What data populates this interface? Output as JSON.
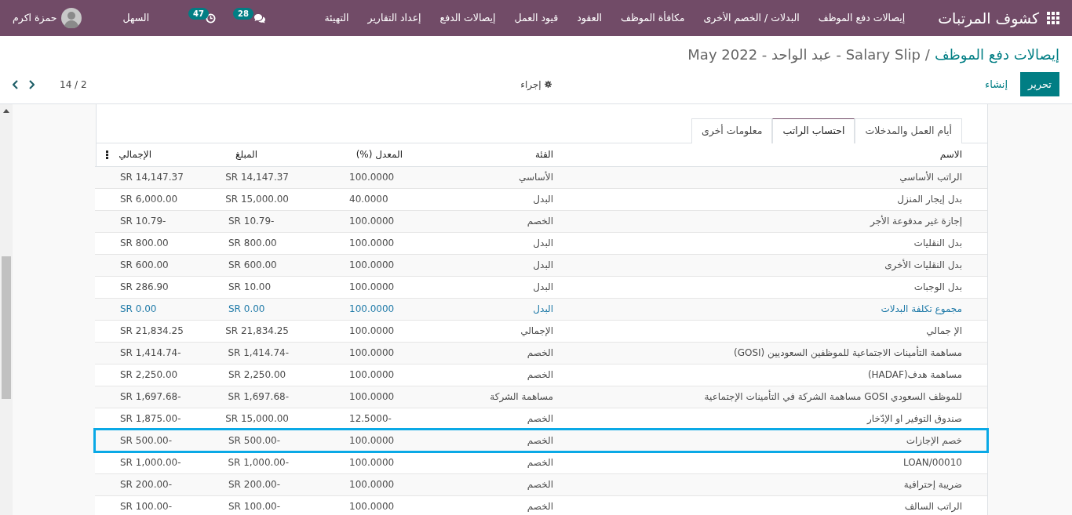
{
  "navbar": {
    "app_title": "كشوف المرتبات",
    "menu": [
      "إيصالات دفع الموظف",
      "البدلات / الخصم الأخرى",
      "مكافأة الموظف",
      "العقود",
      "قيود العمل",
      "إيصالات الدفع",
      "إعداد التقارير",
      "التهيئة"
    ],
    "messages_count": "28",
    "activities_count": "47",
    "company": "السهل",
    "user": "حمزة اكرم"
  },
  "breadcrumb": {
    "parent": "إيصالات دفع الموظف",
    "separator": "/",
    "current": "Salary Slip - عبد الواحد - May 2022"
  },
  "buttons": {
    "edit": "تحرير",
    "create": "إنشاء",
    "action": "إجراء"
  },
  "pager": {
    "text": "2 / 14"
  },
  "tabs": [
    {
      "label": "أيام العمل والمدخلات",
      "selected": false
    },
    {
      "label": "احتساب الراتب",
      "selected": true
    },
    {
      "label": "معلومات أخرى",
      "selected": false
    }
  ],
  "table": {
    "columns": [
      "الاسم",
      "الفئة",
      "المعدل (%)",
      "المبلغ",
      "الإجمالي"
    ],
    "rows": [
      {
        "name": "الراتب الأساسي",
        "category": "الأساسي",
        "rate": "100.0000",
        "amount": "SR 14,147.37",
        "total": "SR 14,147.37",
        "kind": "normal",
        "highlighted": false
      },
      {
        "name": "بدل إيجار المنزل",
        "category": "البدل",
        "rate": "40.0000",
        "amount": "SR 15,000.00",
        "total": "SR 6,000.00",
        "kind": "normal",
        "highlighted": false
      },
      {
        "name": "إجازة غير مدفوعة الأجر",
        "category": "الخصم",
        "rate": "100.0000",
        "amount": "SR 10.79-",
        "total": "SR 10.79-",
        "kind": "normal",
        "highlighted": false
      },
      {
        "name": "بدل النقليات",
        "category": "البدل",
        "rate": "100.0000",
        "amount": "SR 800.00",
        "total": "SR 800.00",
        "kind": "normal",
        "highlighted": false
      },
      {
        "name": "بدل النقليات الأخرى",
        "category": "البدل",
        "rate": "100.0000",
        "amount": "SR 600.00",
        "total": "SR 600.00",
        "kind": "normal",
        "highlighted": false
      },
      {
        "name": "بدل الوجبات",
        "category": "البدل",
        "rate": "100.0000",
        "amount": "SR 10.00",
        "total": "SR 286.90",
        "kind": "normal",
        "highlighted": false
      },
      {
        "name": "مجموع تكلفة البدلات",
        "category": "البدل",
        "rate": "100.0000",
        "amount": "SR 0.00",
        "total": "SR 0.00",
        "kind": "info",
        "highlighted": false
      },
      {
        "name": "الإ جمالي",
        "category": "الإجمالي",
        "rate": "100.0000",
        "amount": "SR 21,834.25",
        "total": "SR 21,834.25",
        "kind": "normal",
        "highlighted": false
      },
      {
        "name": "مساهمة التأمينات الاجتماعية للموظفين السعوديين (GOSI)",
        "category": "الخصم",
        "rate": "100.0000",
        "amount": "SR 1,414.74-",
        "total": "SR 1,414.74-",
        "kind": "normal",
        "highlighted": false
      },
      {
        "name": "مساهمة هدف(HADAF)",
        "category": "الخصم",
        "rate": "100.0000",
        "amount": "SR 2,250.00",
        "total": "SR 2,250.00",
        "kind": "normal",
        "highlighted": false
      },
      {
        "name": "للموظف السعودي GOSI مساهمة الشركة في التأمينات الإجتماعية",
        "category": "مساهمة الشركة",
        "rate": "100.0000",
        "amount": "SR 1,697.68-",
        "total": "SR 1,697.68-",
        "kind": "normal",
        "highlighted": false
      },
      {
        "name": "صندوق التوفير او الإدّخار",
        "category": "الخصم",
        "rate": "12.5000-",
        "amount": "SR 15,000.00",
        "total": "SR 1,875.00-",
        "kind": "normal",
        "highlighted": false
      },
      {
        "name": "خصم الإجازات",
        "category": "الخصم",
        "rate": "100.0000",
        "amount": "SR 500.00-",
        "total": "SR 500.00-",
        "kind": "normal",
        "highlighted": true
      },
      {
        "name": "LOAN/00010",
        "category": "الخصم",
        "rate": "100.0000",
        "amount": "SR 1,000.00-",
        "total": "SR 1,000.00-",
        "kind": "normal",
        "highlighted": false
      },
      {
        "name": "ضريبة إحترافية",
        "category": "الخصم",
        "rate": "100.0000",
        "amount": "SR 200.00-",
        "total": "SR 200.00-",
        "kind": "normal",
        "highlighted": false
      },
      {
        "name": "الراتب السالف",
        "category": "الخصم",
        "rate": "100.0000",
        "amount": "SR 100.00-",
        "total": "SR 100.00-",
        "kind": "normal",
        "highlighted": false
      }
    ]
  }
}
